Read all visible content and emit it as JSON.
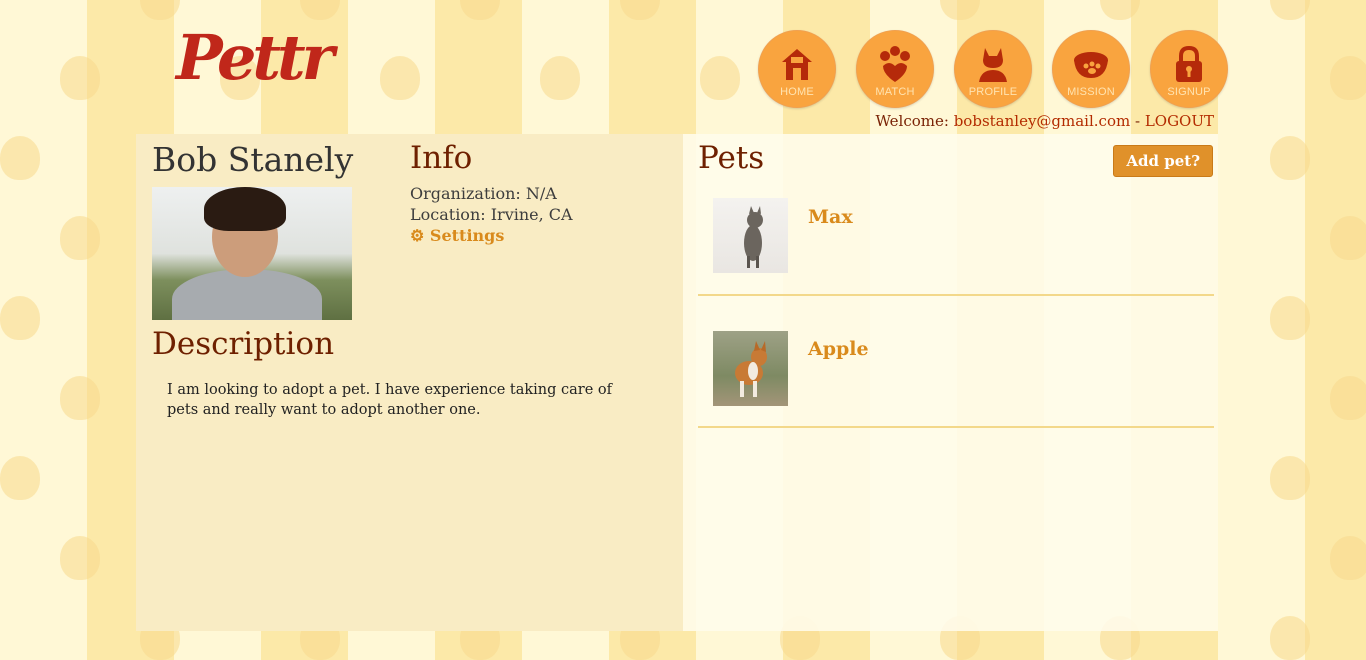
{
  "logo_text": "Pettr",
  "nav": [
    {
      "label": "HOME",
      "icon": "house-icon"
    },
    {
      "label": "MATCH",
      "icon": "paw-heart-icon"
    },
    {
      "label": "PROFILE",
      "icon": "cat-silhouette-icon"
    },
    {
      "label": "MISSION",
      "icon": "pet-bowl-icon"
    },
    {
      "label": "SIGNUP",
      "icon": "lock-icon"
    }
  ],
  "welcome": {
    "prefix": "Welcome: ",
    "email": "bobstanley@gmail.com",
    "separator": " - ",
    "logout": "LOGOUT"
  },
  "profile": {
    "name": "Bob Stanely",
    "info_title": "Info",
    "organization": "Organization: N/A",
    "location": "Location: Irvine, CA",
    "settings_icon": "gear-icon",
    "settings_label": "Settings",
    "description_title": "Description",
    "description": "I am looking to adopt a pet. I have experience taking care of pets and really want to adopt another one."
  },
  "pets": {
    "title": "Pets",
    "add_label": "Add pet?",
    "items": [
      {
        "name": "Max"
      },
      {
        "name": "Apple"
      }
    ]
  },
  "colors": {
    "accent": "#e0912a",
    "brand_red": "#c0271a",
    "heading": "#6e2000",
    "nav_orange": "#f9a43f"
  }
}
